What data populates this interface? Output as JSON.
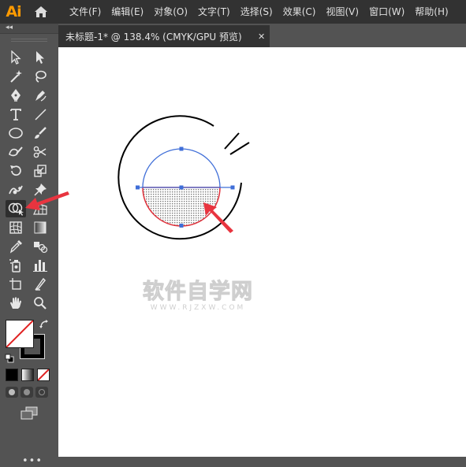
{
  "app": {
    "logo": "Ai",
    "home_icon": "home-icon"
  },
  "menu": [
    "文件(F)",
    "编辑(E)",
    "对象(O)",
    "文字(T)",
    "选择(S)",
    "效果(C)",
    "视图(V)",
    "窗口(W)",
    "帮助(H)"
  ],
  "tools_panel": {
    "collapse_label": "◂◂",
    "tools": [
      "selection-tool",
      "direct-selection-tool",
      "magic-wand-tool",
      "lasso-tool",
      "pen-tool",
      "curvature-tool",
      "type-tool",
      "line-segment-tool",
      "ellipse-tool",
      "paintbrush-tool",
      "shaper-tool",
      "scissors-tool",
      "rotate-tool",
      "scale-tool",
      "puppet-warp-tool",
      "pin-tool",
      "shape-builder-tool",
      "perspective-grid-tool",
      "mesh-tool",
      "gradient-tool",
      "eyedropper-tool",
      "blend-tool",
      "symbol-sprayer-tool",
      "column-graph-tool",
      "artboard-tool",
      "slice-tool",
      "hand-tool",
      "zoom-tool"
    ],
    "active_tool": "shape-builder-tool",
    "more_label": "•••",
    "colors": {
      "fill": "#ffffff",
      "stroke": "#000000",
      "none_slash": "#e02020"
    }
  },
  "document": {
    "tab_title": "未标题-1* @ 138.4% (CMYK/GPU 预览)",
    "close_label": "✕"
  },
  "artwork": {
    "colors": {
      "outer_ring": "#000000",
      "selection": "#3f6ed8",
      "highlight": "#e0303a",
      "arrow": "#e8343f"
    }
  },
  "watermark": {
    "main": "软件自学网",
    "sub": "WWW.RJZXW.COM"
  }
}
